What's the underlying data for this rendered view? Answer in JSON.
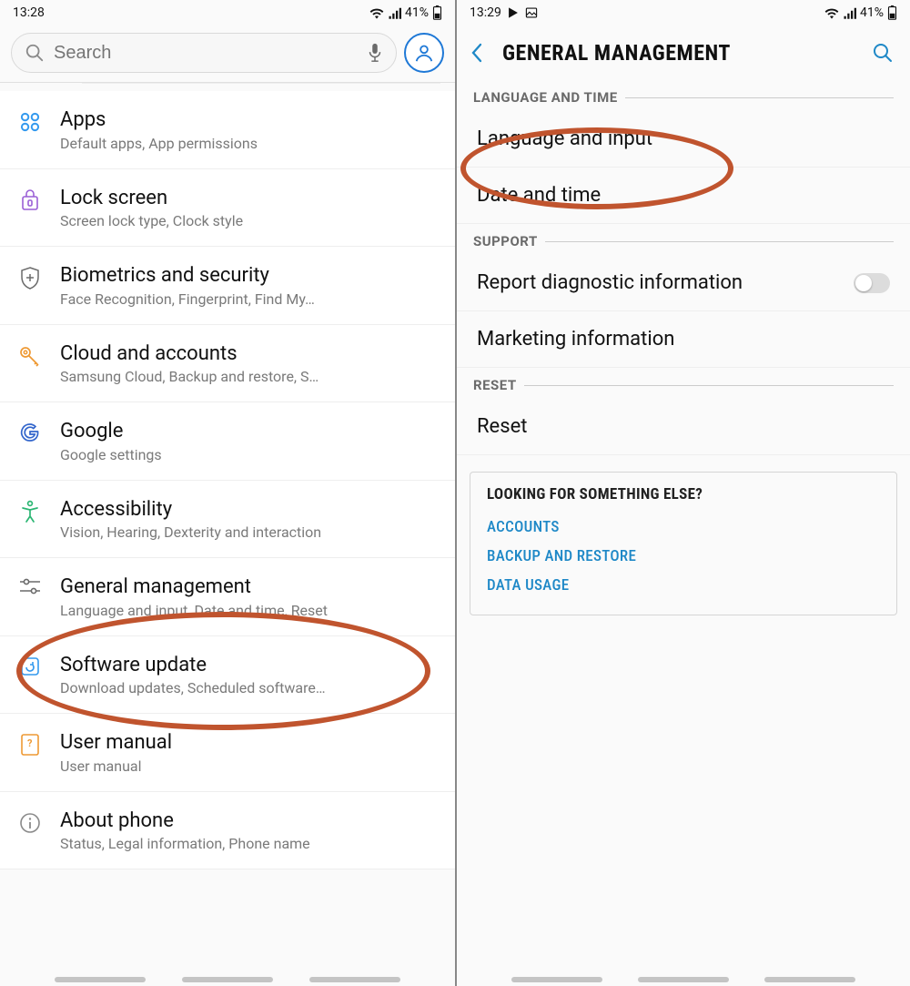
{
  "left": {
    "status": {
      "time": "13:28",
      "battery": "41%"
    },
    "search": {
      "placeholder": "Search"
    },
    "items": [
      {
        "title": "Apps",
        "sub": "Default apps, App permissions"
      },
      {
        "title": "Lock screen",
        "sub": "Screen lock type, Clock style"
      },
      {
        "title": "Biometrics and security",
        "sub": "Face Recognition, Fingerprint, Find My…"
      },
      {
        "title": "Cloud and accounts",
        "sub": "Samsung Cloud, Backup and restore, S…"
      },
      {
        "title": "Google",
        "sub": "Google settings"
      },
      {
        "title": "Accessibility",
        "sub": "Vision, Hearing, Dexterity and interaction"
      },
      {
        "title": "General management",
        "sub": "Language and input, Date and time, Reset"
      },
      {
        "title": "Software update",
        "sub": "Download updates, Scheduled software…"
      },
      {
        "title": "User manual",
        "sub": "User manual"
      },
      {
        "title": "About phone",
        "sub": "Status, Legal information, Phone name"
      }
    ]
  },
  "right": {
    "status": {
      "time": "13:29",
      "battery": "41%"
    },
    "header": "GENERAL MANAGEMENT",
    "sections": {
      "lang_time": {
        "header": "LANGUAGE AND TIME",
        "items": [
          "Language and input",
          "Date and time"
        ]
      },
      "support": {
        "header": "SUPPORT",
        "items": [
          "Report diagnostic information",
          "Marketing information"
        ]
      },
      "reset": {
        "header": "RESET",
        "items": [
          "Reset"
        ]
      }
    },
    "card": {
      "title": "LOOKING FOR SOMETHING ELSE?",
      "links": [
        "ACCOUNTS",
        "BACKUP AND RESTORE",
        "DATA USAGE"
      ]
    }
  }
}
